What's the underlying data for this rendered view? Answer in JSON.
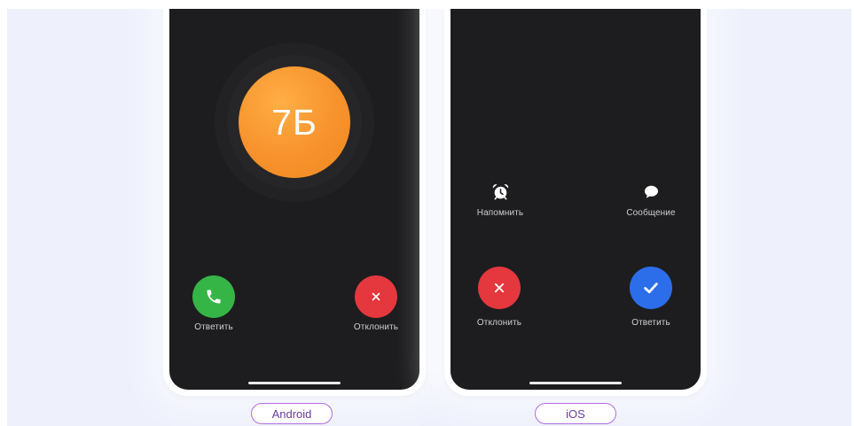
{
  "colors": {
    "page_background": "#EEF0FC",
    "phone_frame": "#FFFFFF",
    "screen_background": "#1D1D1F",
    "avatar_orange": "#F7922C",
    "answer_green": "#35B546",
    "decline_red": "#E4373E",
    "answer_blue": "#2C6DEA",
    "pill_border": "#B56BE4",
    "pill_text": "#6A3AA2",
    "caption_text": "#CFCFD2"
  },
  "phones": {
    "android": {
      "platform_label": "Android",
      "avatar_initials": "7Б",
      "answer": {
        "label": "Ответить",
        "icon": "phone-icon"
      },
      "decline": {
        "label": "Отклонить",
        "icon": "close-icon"
      }
    },
    "ios": {
      "platform_label": "iOS",
      "remind": {
        "label": "Напомнить",
        "icon": "alarm-clock-icon"
      },
      "message": {
        "label": "Сообщение",
        "icon": "chat-bubble-icon"
      },
      "decline": {
        "label": "Отклонить",
        "icon": "close-icon"
      },
      "answer": {
        "label": "Ответить",
        "icon": "checkmark-icon"
      }
    }
  }
}
